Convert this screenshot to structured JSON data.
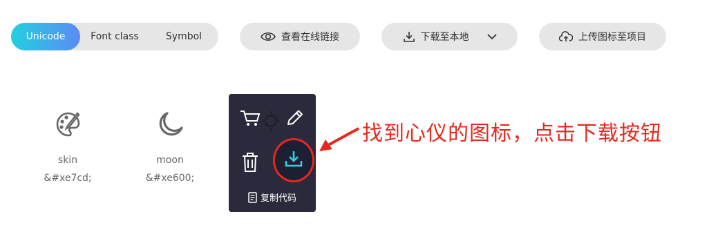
{
  "tabs": [
    "Unicode",
    "Font class",
    "Symbol"
  ],
  "actions": {
    "view_link": "查看在线链接",
    "download": "下载至本地",
    "upload": "上传图标至项目"
  },
  "icons": [
    {
      "name": "skin",
      "code": "&#xe7cd;",
      "icon": "palette-icon"
    },
    {
      "name": "moon",
      "code": "&#xe600;",
      "icon": "moon-icon"
    }
  ],
  "hover_card": {
    "copy_label": "复制代码",
    "icons": [
      "cart-icon",
      "edit-icon",
      "trash-icon",
      "download-icon",
      "copy-icon"
    ]
  },
  "annotation": {
    "text": "找到心仪的图标，点击下载按钮",
    "color": "#e8281f"
  },
  "colors": {
    "accent_start": "#22d0e0",
    "accent_end": "#5b8bf5",
    "download_icon": "#2ad4dc",
    "card_bg": "#2a2a3c"
  }
}
